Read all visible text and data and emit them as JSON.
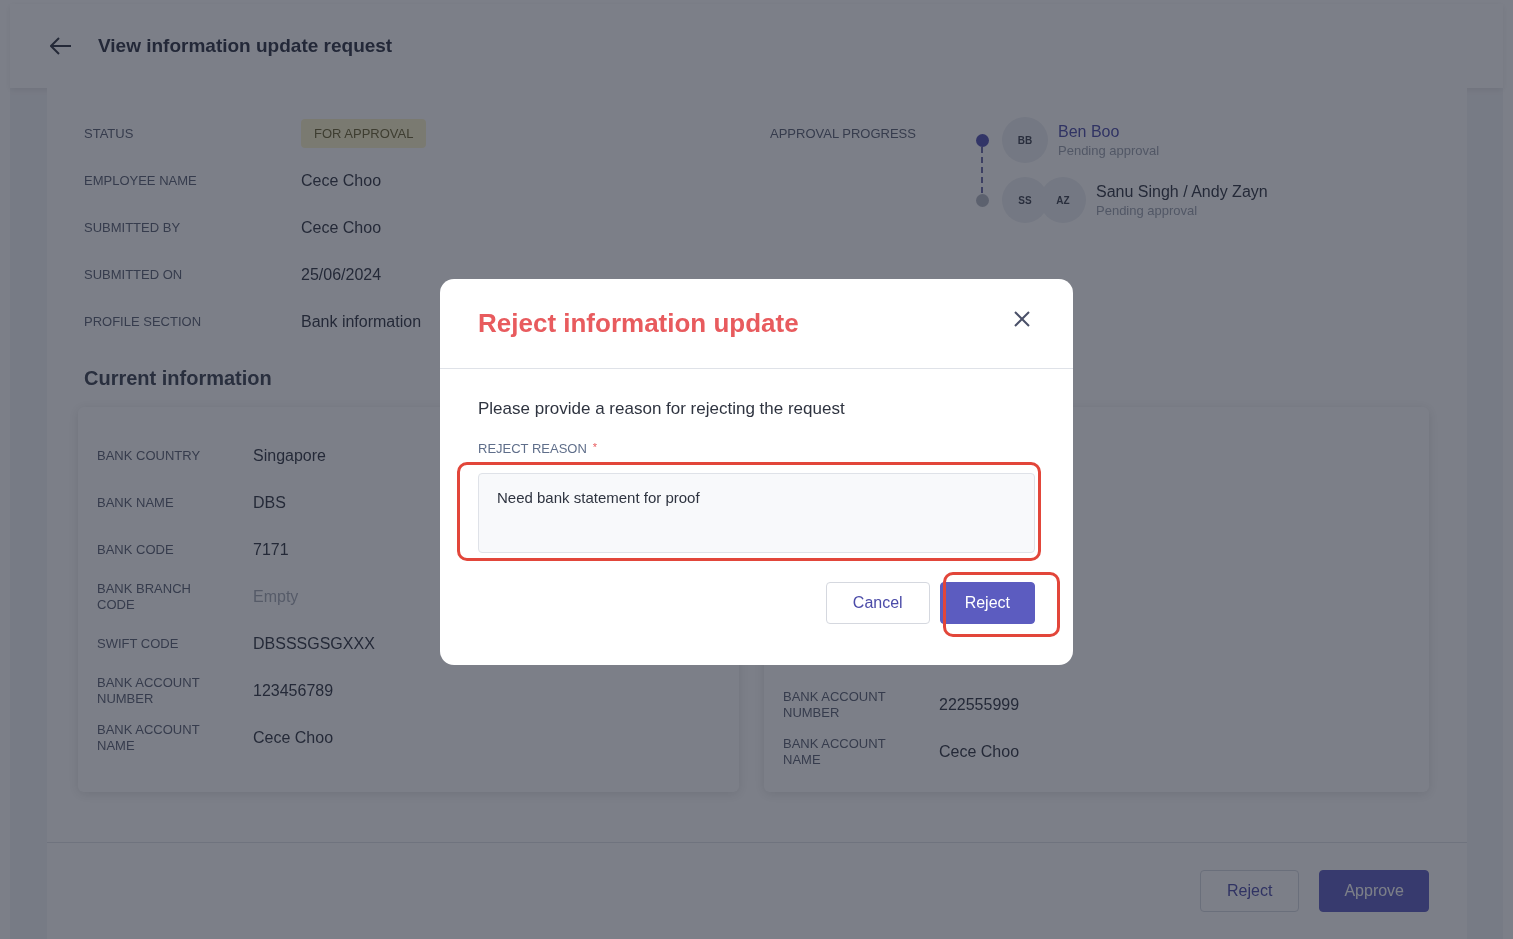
{
  "header": {
    "title": "View information update request"
  },
  "details": [
    {
      "label": "STATUS",
      "value": "FOR APPROVAL",
      "kind": "badge"
    },
    {
      "label": "EMPLOYEE NAME",
      "value": "Cece Choo",
      "kind": "text"
    },
    {
      "label": "SUBMITTED BY",
      "value": "Cece Choo",
      "kind": "text"
    },
    {
      "label": "SUBMITTED ON",
      "value": "25/06/2024",
      "kind": "text"
    },
    {
      "label": "PROFILE SECTION",
      "value": "Bank information",
      "kind": "text"
    }
  ],
  "approval": {
    "label": "APPROVAL PROGRESS",
    "steps": [
      {
        "name": "Ben Boo",
        "status": "Pending approval",
        "active": true,
        "avatars": [
          "BB"
        ]
      },
      {
        "name": "Sanu Singh / Andy Zayn",
        "status": "Pending approval",
        "active": false,
        "avatars": [
          "SS",
          "AZ"
        ]
      }
    ]
  },
  "current": {
    "heading": "Current information",
    "rows": [
      {
        "label": "BANK COUNTRY",
        "value": "Singapore",
        "empty": false
      },
      {
        "label": "BANK NAME",
        "value": "DBS",
        "empty": false
      },
      {
        "label": "BANK CODE",
        "value": "7171",
        "empty": false
      },
      {
        "label": "BANK BRANCH CODE",
        "value": "Empty",
        "empty": true
      },
      {
        "label": "SWIFT CODE",
        "value": "DBSSSGSGXXX",
        "empty": false
      },
      {
        "label": "BANK ACCOUNT NUMBER",
        "value": "123456789",
        "empty": false
      },
      {
        "label": "BANK ACCOUNT NAME",
        "value": "Cece Choo",
        "empty": false
      }
    ]
  },
  "new_info": {
    "rows": [
      {
        "label": "BANK ACCOUNT NUMBER",
        "value": "222555999",
        "empty": false
      },
      {
        "label": "BANK ACCOUNT NAME",
        "value": "Cece Choo",
        "empty": false
      }
    ]
  },
  "footer": {
    "buttons": [
      {
        "label": "Reject",
        "kind": "secondary"
      },
      {
        "label": "Approve",
        "kind": "primary"
      }
    ]
  },
  "modal": {
    "title": "Reject information update",
    "prompt": "Please provide a reason for rejecting the request",
    "field_label": "REJECT REASON",
    "required_mark": "*",
    "value": "Need bank statement for proof",
    "field_highlighted": true,
    "buttons": [
      {
        "label": "Cancel",
        "kind": "secondary",
        "highlighted": false
      },
      {
        "label": "Reject",
        "kind": "primary",
        "highlighted": true
      }
    ]
  }
}
